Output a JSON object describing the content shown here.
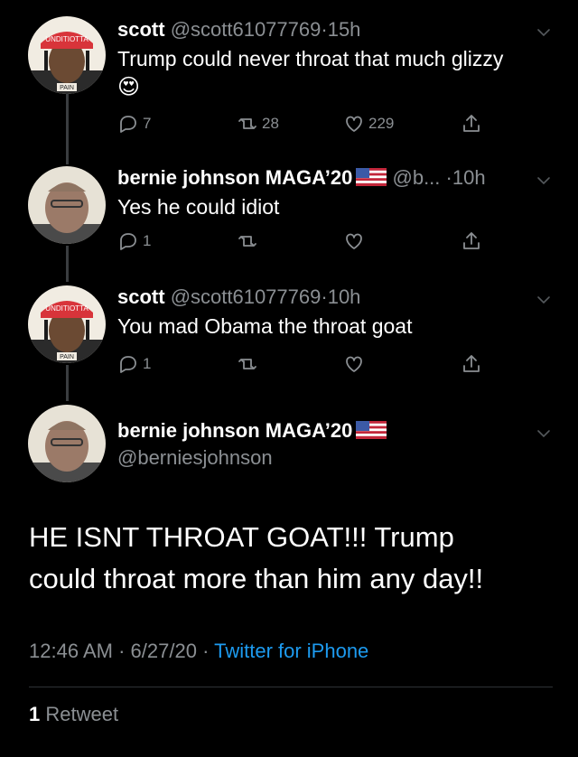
{
  "tweets": [
    {
      "name": "scott",
      "handle": "@scott61077769",
      "dot": "·",
      "time": "15h",
      "text": "Trump could never throat that much glizzy",
      "emoji": "😍",
      "replies": "7",
      "retweets": "28",
      "likes": "229",
      "avatar_caps_text": "UNDITIOTTA",
      "avatar_shirt_text": "PAIN"
    },
    {
      "name": "bernie johnson MAGA’20",
      "handle": "@b...",
      "dot": "·",
      "time": "10h",
      "text": "Yes he could idiot",
      "replies": "1",
      "retweets": "",
      "likes": ""
    },
    {
      "name": "scott",
      "handle": "@scott61077769",
      "dot": "·",
      "time": "10h",
      "text": "You mad Obama the throat goat",
      "replies": "1",
      "retweets": "",
      "likes": "",
      "avatar_caps_text": "UNDITIOTTA",
      "avatar_shirt_text": "PAIN"
    }
  ],
  "main_tweet": {
    "name": "bernie johnson MAGA’20",
    "handle": "@berniesjohnson",
    "text_line1": "HE ISNT THROAT GOAT!!! Trump",
    "text_line2": "could throat more than him any day!!",
    "time": "12:46 AM",
    "dot1": "·",
    "date": "6/27/20",
    "dot2": "·",
    "source": "Twitter for iPhone",
    "retweet_count": "1",
    "retweet_label": "Retweet"
  },
  "colors": {
    "background": "#000000",
    "muted": "#8b8f93",
    "link": "#1d9bf0",
    "cap_red": "#d8343a"
  }
}
